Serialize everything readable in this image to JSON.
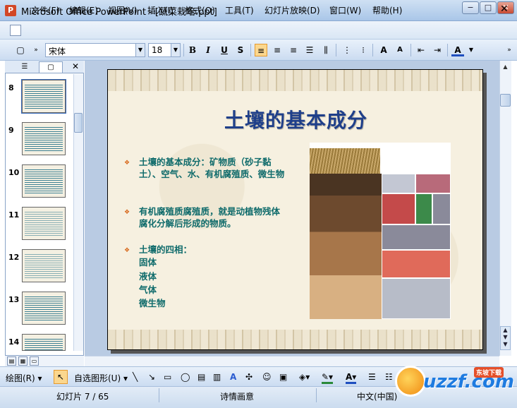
{
  "window": {
    "title": "Microsoft Office PowerPoint - [蔬菜栽培.ppt]",
    "minimize": "−",
    "maximize": "□",
    "close": "✕"
  },
  "menu": {
    "items": [
      "文件(F)",
      "编辑(E)",
      "视图(V)",
      "插入(I)",
      "格式(O)",
      "工具(T)",
      "幻灯片放映(D)",
      "窗口(W)",
      "帮助(H)"
    ],
    "close": "✕"
  },
  "toolbar": {
    "font_name": "宋体",
    "font_size": "18",
    "bold": "B",
    "italic": "I",
    "underline": "U",
    "shadow": "S"
  },
  "slides_pane": {
    "numbers": [
      "8",
      "9",
      "10",
      "11",
      "12",
      "13",
      "14"
    ],
    "close": "✕"
  },
  "slide": {
    "title": "土壤的基本成分",
    "bullets": [
      "土壤的基本成分：矿物质（砂子黏土）、空气、水、有机腐殖质、微生物",
      "有机腐殖质腐殖质，就是动植物残体腐化分解后形成的物质。",
      "土壤的四相："
    ],
    "phases": [
      "固体",
      "液体",
      "气体",
      "微生物"
    ]
  },
  "drawing_toolbar": {
    "draw": "绘图(R) ▾",
    "autoshapes": "自选图形(U) ▾"
  },
  "status": {
    "slide_info": "幻灯片 7 / 65",
    "design": "诗情画意",
    "language": "中文(中国)"
  },
  "watermark": {
    "text": "uzzf.com",
    "small": "东坡下载"
  }
}
